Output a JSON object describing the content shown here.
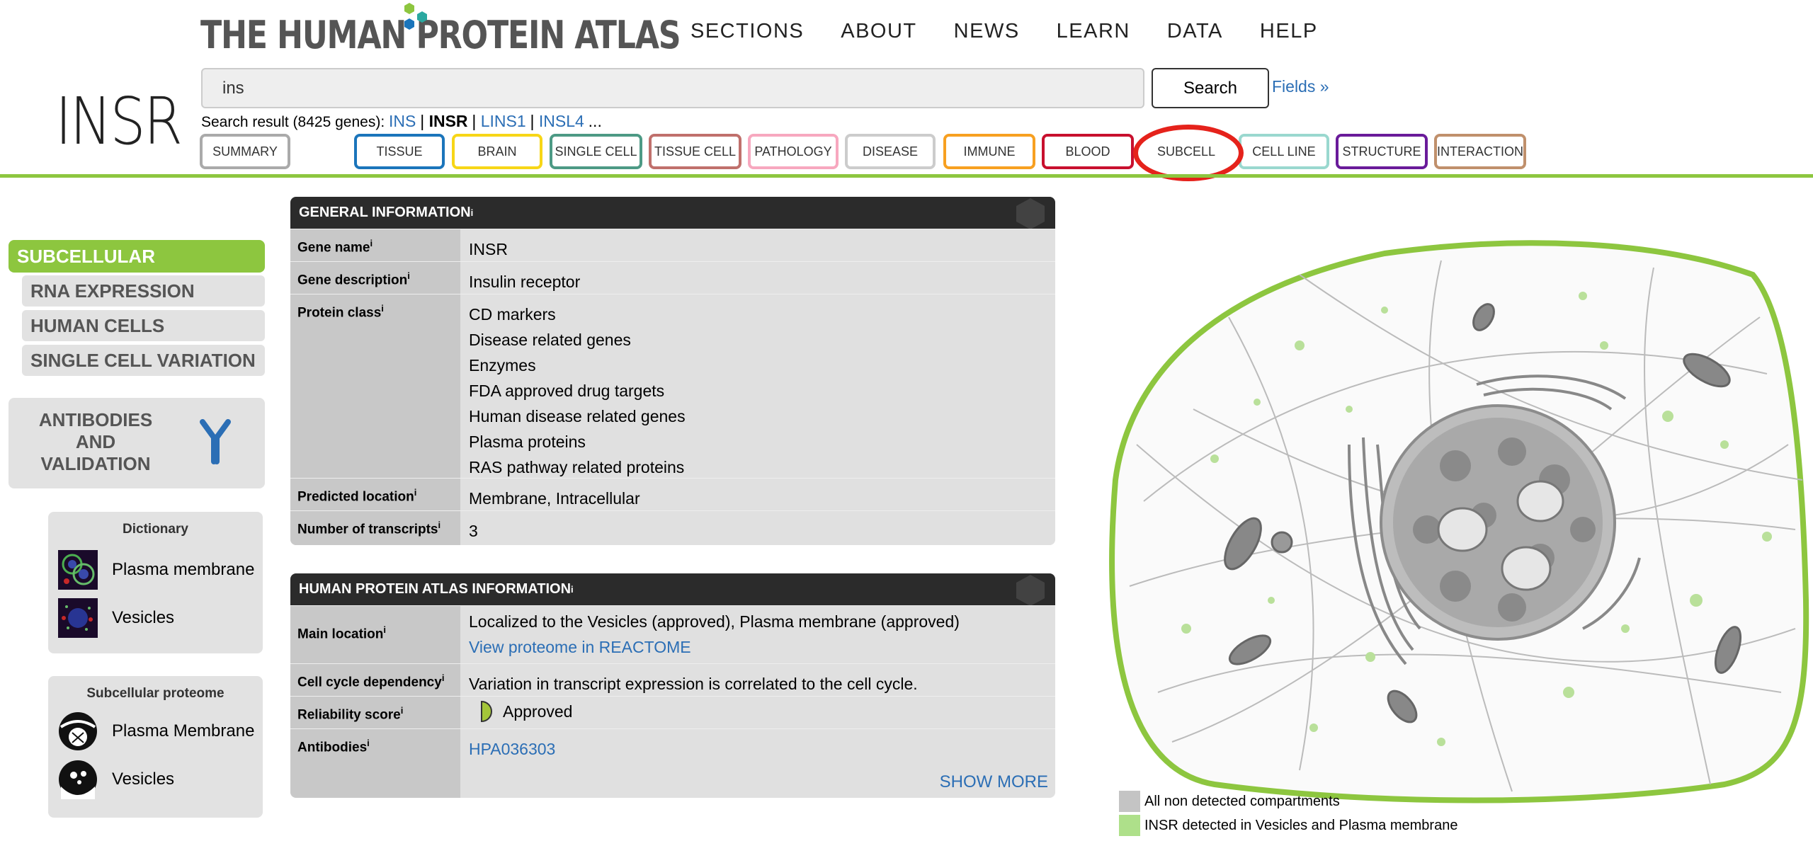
{
  "logo": {
    "text": "THE HUMAN PROTEIN ATLAS"
  },
  "topnav": [
    "SECTIONS",
    "ABOUT",
    "NEWS",
    "LEARN",
    "DATA",
    "HELP"
  ],
  "gene_symbol": "INSR",
  "search": {
    "value": "ins",
    "button_label": "Search",
    "fields_link": "Fields »"
  },
  "search_result": {
    "prefix": "Search result (8425 genes):",
    "genes": [
      "INS",
      "INSR",
      "LINS1",
      "INSL4"
    ],
    "current": "INSR",
    "more": "..."
  },
  "tabs": [
    {
      "label": "SUMMARY",
      "color": "#aaaaaa"
    },
    {
      "label": "TISSUE",
      "color": "#1b75bb"
    },
    {
      "label": "BRAIN",
      "color": "#f7d617"
    },
    {
      "label": "SINGLE CELL",
      "color": "#4d9a85"
    },
    {
      "label": "TISSUE CELL",
      "color": "#c0706c"
    },
    {
      "label": "PATHOLOGY",
      "color": "#f7a8bf"
    },
    {
      "label": "DISEASE",
      "color": "#cccccc"
    },
    {
      "label": "IMMUNE",
      "color": "#f7a021"
    },
    {
      "label": "BLOOD",
      "color": "#c8102e"
    },
    {
      "label": "SUBCELL",
      "color": "#8dc63f"
    },
    {
      "label": "CELL LINE",
      "color": "#9ad8cf"
    },
    {
      "label": "STRUCTURE",
      "color": "#6a1b9a"
    },
    {
      "label": "INTERACTION",
      "color": "#c0906c"
    }
  ],
  "active_tab": "SUBCELL",
  "left_menu": {
    "active": "SUBCELLULAR",
    "items": [
      "RNA EXPRESSION",
      "HUMAN CELLS",
      "SINGLE CELL VARIATION"
    ],
    "antibodies": "ANTIBODIES AND VALIDATION"
  },
  "dictionary": {
    "title": "Dictionary",
    "items": [
      "Plasma membrane",
      "Vesicles"
    ]
  },
  "subcellular_proteome": {
    "title": "Subcellular proteome",
    "items": [
      "Plasma Membrane",
      "Vesicles"
    ]
  },
  "general_info": {
    "title": "GENERAL INFORMATION",
    "info_mark": "i",
    "rows": {
      "gene_name": {
        "key": "Gene name",
        "value": "INSR"
      },
      "gene_description": {
        "key": "Gene description",
        "value": "Insulin receptor"
      },
      "protein_class": {
        "key": "Protein class",
        "values": [
          "CD markers",
          "Disease related genes",
          "Enzymes",
          "FDA approved drug targets",
          "Human disease related genes",
          "Plasma proteins",
          "RAS pathway related proteins"
        ]
      },
      "predicted_location": {
        "key": "Predicted location",
        "value": "Membrane, Intracellular"
      },
      "num_transcripts": {
        "key": "Number of transcripts",
        "value": "3"
      }
    }
  },
  "hpa_info": {
    "title": "HUMAN PROTEIN ATLAS INFORMATION",
    "rows": {
      "main_location": {
        "key": "Main location",
        "value": "Localized to the Vesicles (approved), Plasma membrane (approved)",
        "link": "View proteome in REACTOME"
      },
      "cell_cycle": {
        "key": "Cell cycle dependency",
        "value": "Variation in transcript expression is correlated to the cell cycle."
      },
      "reliability": {
        "key": "Reliability score",
        "value": "Approved"
      },
      "antibodies": {
        "key": "Antibodies",
        "value": "HPA036303"
      }
    },
    "show_more": "SHOW MORE"
  },
  "legend": {
    "items": [
      {
        "label": "All non detected compartments",
        "color": "#c4c4c4"
      },
      {
        "label": "INSR detected in Vesicles and Plasma membrane",
        "color": "#aee08a"
      }
    ]
  },
  "colors": {
    "accent_green": "#8dc63f",
    "link_blue": "#2b6eb5",
    "highlight_red": "#e5221b"
  }
}
